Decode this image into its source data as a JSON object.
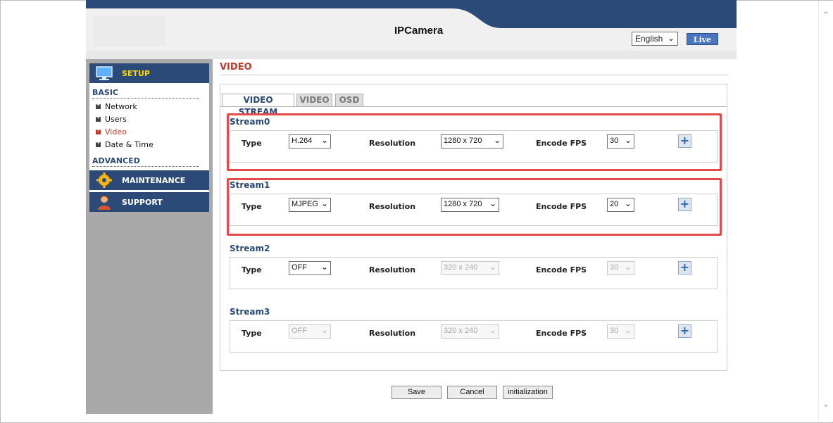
{
  "header": {
    "brand": "IPCamera",
    "language": "English",
    "live_label": "Live"
  },
  "sidebar": {
    "setup": "SETUP",
    "basic_label": "BASIC",
    "items": [
      "Network",
      "Users",
      "Video",
      "Date & Time"
    ],
    "active_item": "Video",
    "advanced_label": "ADVANCED",
    "maintenance": "MAINTENANCE",
    "support": "SUPPORT"
  },
  "main": {
    "title": "VIDEO",
    "tabs": [
      "VIDEO STREAM",
      "VIDEO",
      "OSD"
    ],
    "active_tab": "VIDEO STREAM",
    "labels": {
      "type": "Type",
      "resolution": "Resolution",
      "fps": "Encode FPS"
    },
    "streams": [
      {
        "name": "Stream0",
        "type": "H.264",
        "resolution": "1280 x 720",
        "fps": "30"
      },
      {
        "name": "Stream1",
        "type": "MJPEG",
        "resolution": "1280 x 720",
        "fps": "20"
      },
      {
        "name": "Stream2",
        "type": "OFF",
        "resolution": "320 x 240",
        "fps": "30"
      },
      {
        "name": "Stream3",
        "type": "OFF",
        "resolution": "320 x 240",
        "fps": "30"
      }
    ],
    "buttons": {
      "save": "Save",
      "cancel": "Cancel",
      "init": "initialization"
    }
  },
  "colors": {
    "nav": "#2c4a78",
    "accent": "#c0392b",
    "highlight": "#e34a4a",
    "setup_text": "#ffd700"
  },
  "icons": {
    "setup": "monitor-icon",
    "maintenance": "gear-icon",
    "support": "support-person-icon",
    "add": "plus-icon"
  }
}
